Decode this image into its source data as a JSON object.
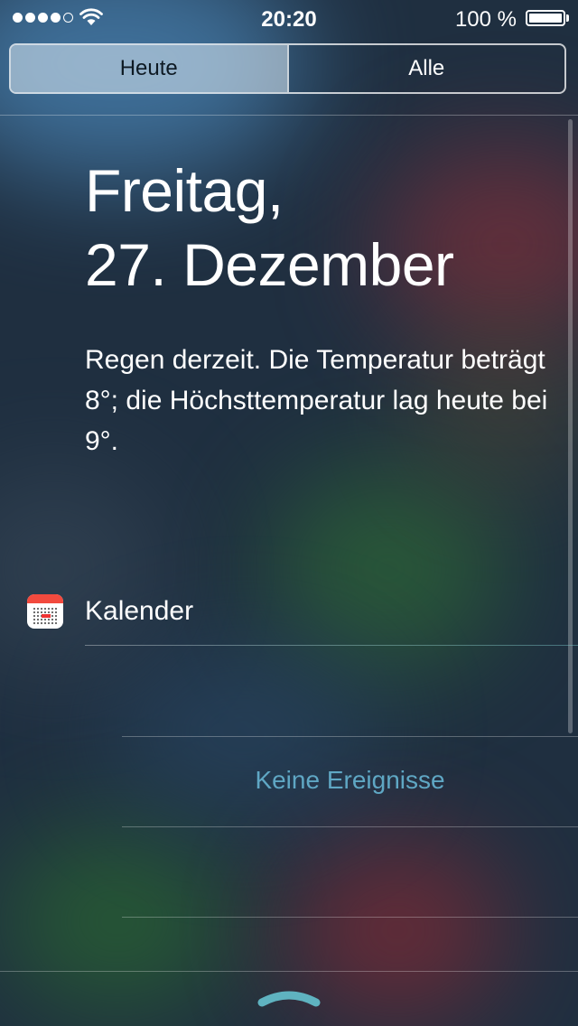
{
  "status": {
    "time": "20:20",
    "battery": "100 %",
    "signal_dots_filled": 4,
    "signal_dots_total": 5
  },
  "tabs": [
    {
      "label": "Heute",
      "active": true
    },
    {
      "label": "Alle",
      "active": false
    }
  ],
  "today": {
    "date_line1": "Freitag,",
    "date_line2": "27. Dezember",
    "weather": "Regen derzeit. Die Temperatur beträgt 8°; die Höchsttemperatur lag heute bei 9°."
  },
  "calendar": {
    "title": "Kalender",
    "empty": "Keine Ereignisse"
  },
  "colors": {
    "accent_text": "#5fa7c4",
    "calendar_red": "#f24a3e",
    "handle": "#5fb3c0"
  }
}
